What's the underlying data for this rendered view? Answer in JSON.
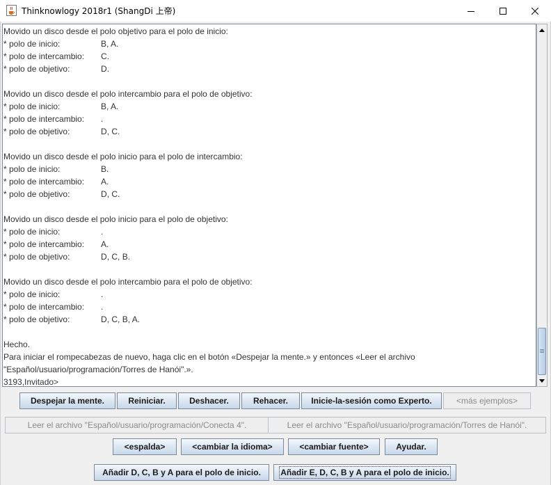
{
  "window": {
    "title": "Thinknowlogy 2018r1 (ShangDi 上帝)",
    "icons": {
      "app": "java-cup-icon",
      "minimize": "minimize-icon",
      "maximize": "maximize-icon",
      "close": "close-icon"
    }
  },
  "output": {
    "text": "Movido un disco desde el polo objetivo para el polo de inicio:\n* polo de inicio:\t\t\tB, A.\n* polo de intercambio:\t\tC.\n* polo de objetivo:\t\t\tD.\n\nMovido un disco desde el polo intercambio para el polo de objetivo:\n* polo de inicio:\t\t\tB, A.\n* polo de intercambio:\t\t.\n* polo de objetivo:\t\t\tD, C.\n\nMovido un disco desde el polo inicio para el polo de intercambio:\n* polo de inicio:\t\t\tB.\n* polo de intercambio:\t\tA.\n* polo de objetivo:\t\t\tD, C.\n\nMovido un disco desde el polo inicio para el polo de objetivo:\n* polo de inicio:\t\t\t.\n* polo de intercambio:\t\tA.\n* polo de objetivo:\t\t\tD, C, B.\n\nMovido un disco desde el polo intercambio para el polo de objetivo:\n* polo de inicio:\t\t\t.\n* polo de intercambio:\t\t.\n* polo de objetivo:\t\t\tD, C, B, A.\n\nHecho.\nPara iniciar el rompecabezas de nuevo, haga clic en el botón «Despejar la mente.» y entonces «Leer el archivo\n\"Español/usuario/programación/Torres de Hanói\".».\n3193,Invitado>"
  },
  "buttons": {
    "clear_mind": "Despejar la mente.",
    "restart": "Reiniciar.",
    "undo": "Deshacer.",
    "redo": "Rehacer.",
    "login_expert": "Inicie-la-sesión como Experto.",
    "more_examples": "<más ejemplos>",
    "read_connect4": "Leer el archivo \"Español/usuario/programación/Conecta 4\".",
    "read_hanoi": "Leer el archivo \"Español/usuario/programación/Torres de Hanói\".",
    "back": "<espalda>",
    "change_language": "<cambiar la idioma>",
    "change_font": "<cambiar fuente>",
    "help": "Ayudar.",
    "add_dcba": "Añadir D, C, B y A para el polo de inicio.",
    "add_edcba": "Añadir E, D, C, B y A para el polo de inicio."
  }
}
